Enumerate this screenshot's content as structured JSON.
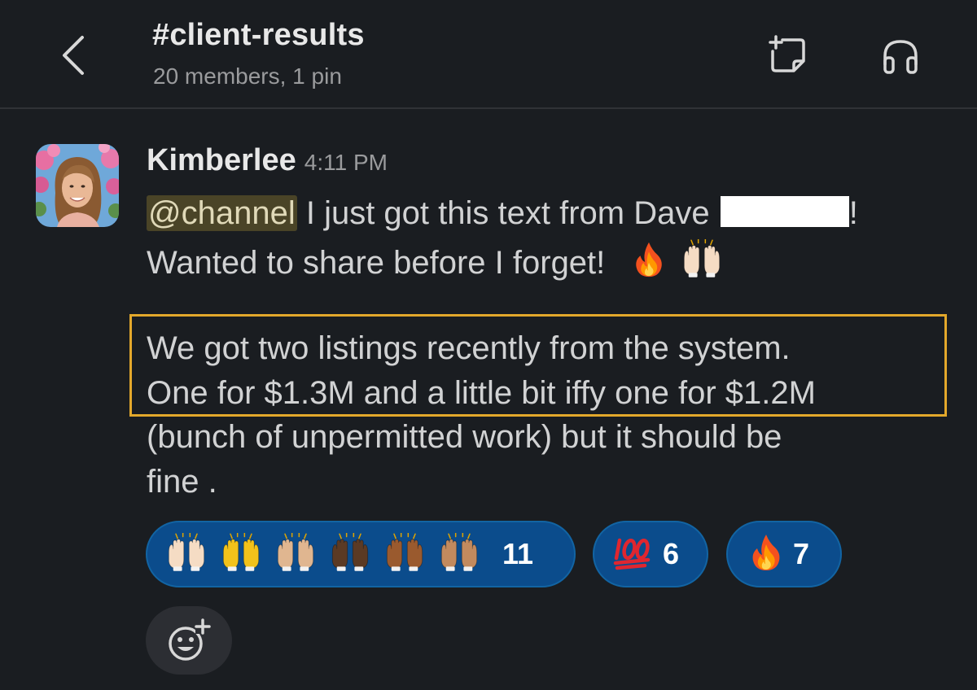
{
  "header": {
    "channel_name": "#client-results",
    "subtitle": "20 members, 1 pin"
  },
  "message": {
    "author": "Kimberlee",
    "time": "4:11 PM",
    "mention": "@channel",
    "line1_text": " I just got this text from Dave ",
    "line1_end": "!",
    "line2_text": "Wanted to share before I forget!",
    "quote_line1": "We got two listings recently from the system.",
    "quote_line2": "One for $1.3M and a little bit iffy one for $1.2M",
    "line5": "(bunch of unpermitted work) but it should be",
    "line6": "fine ."
  },
  "reactions": [
    {
      "emoji": "raised-hands-skin-tones",
      "count": "11"
    },
    {
      "emoji": "hundred-points",
      "count": "6"
    },
    {
      "emoji": "fire",
      "count": "7"
    }
  ],
  "colors": {
    "background": "#1a1d21",
    "reaction_bg": "#0b4c8c",
    "highlight_border": "#e3a82b",
    "mention_bg": "#4a4427",
    "hands_skin_tones": [
      "#f5dcc4",
      "#f2c21a",
      "#e0b690",
      "#5b3a24",
      "#9a5a2e",
      "#c28a5e"
    ]
  },
  "icons": {
    "back": "chevron-left-icon",
    "canvas": "new-canvas-icon",
    "huddle": "headphones-icon",
    "add_reaction": "add-reaction-icon"
  }
}
